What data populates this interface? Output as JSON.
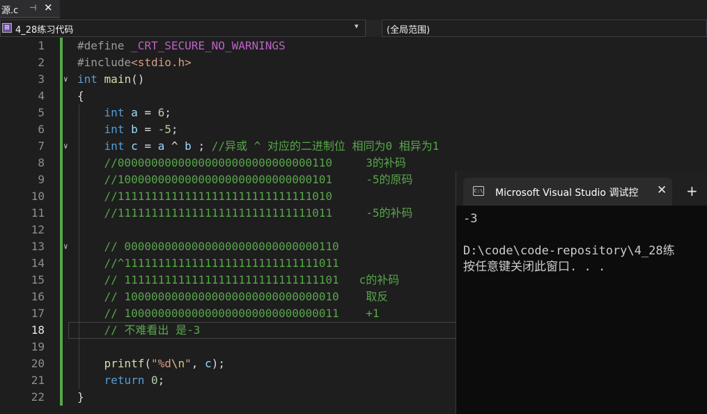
{
  "tab": {
    "title": "源.c",
    "pin_icon": "pin-icon",
    "close_icon": "close-icon"
  },
  "navbar": {
    "project": "4_28练习代码",
    "scope": "(全局范围)"
  },
  "editor": {
    "active_line": "18",
    "lines": [
      {
        "n": "1",
        "p": [
          "#define",
          " ",
          "_CRT_SECURE_NO_WARNINGS"
        ]
      },
      {
        "n": "2",
        "p": [
          "#include",
          "<stdio.h>"
        ]
      },
      {
        "n": "3",
        "p": [
          "int",
          " ",
          "main",
          "()"
        ]
      },
      {
        "n": "4",
        "p": [
          "{"
        ]
      },
      {
        "n": "5",
        "p": [
          "    ",
          "int",
          " ",
          "a",
          " = ",
          "6",
          ";"
        ]
      },
      {
        "n": "6",
        "p": [
          "    ",
          "int",
          " ",
          "b",
          " = ",
          "-5",
          ";"
        ]
      },
      {
        "n": "7",
        "p": [
          "    ",
          "int",
          " ",
          "c",
          " = ",
          "a",
          " ^ ",
          "b",
          " ; ",
          "//异或 ^ 对应的二进制位 相同为0 相异为1"
        ]
      },
      {
        "n": "8",
        "p": [
          "    ",
          "//00000000000000000000000000000110     3的补码"
        ]
      },
      {
        "n": "9",
        "p": [
          "    ",
          "//10000000000000000000000000000101     -5的原码"
        ]
      },
      {
        "n": "10",
        "p": [
          "    ",
          "//11111111111111111111111111111010"
        ]
      },
      {
        "n": "11",
        "p": [
          "    ",
          "//11111111111111111111111111111011     -5的补码"
        ]
      },
      {
        "n": "12",
        "p": [
          ""
        ]
      },
      {
        "n": "13",
        "p": [
          "    ",
          "// 00000000000000000000000000000110"
        ]
      },
      {
        "n": "14",
        "p": [
          "    ",
          "//^11111111111111111111111111111011"
        ]
      },
      {
        "n": "15",
        "p": [
          "    ",
          "// 11111111111111111111111111111101   c的补码"
        ]
      },
      {
        "n": "16",
        "p": [
          "    ",
          "// 10000000000000000000000000000010    取反"
        ]
      },
      {
        "n": "17",
        "p": [
          "    ",
          "// 10000000000000000000000000000011    +1"
        ]
      },
      {
        "n": "18",
        "p": [
          "    ",
          "// 不难看出 是-3"
        ]
      },
      {
        "n": "19",
        "p": [
          ""
        ]
      },
      {
        "n": "20",
        "p": [
          "    ",
          "printf",
          "(",
          "\"%d",
          "\\n",
          "\"",
          ", ",
          "c",
          ");"
        ]
      },
      {
        "n": "21",
        "p": [
          "    ",
          "return",
          " ",
          "0",
          ";"
        ]
      },
      {
        "n": "22",
        "p": [
          "}"
        ]
      }
    ]
  },
  "terminal": {
    "tab_title": "Microsoft Visual Studio 调试控",
    "icon": "console-icon",
    "new_tab_label": "+",
    "output": [
      "-3",
      "",
      "D:\\code\\code-repository\\4_28练",
      "按任意键关闭此窗口. . ."
    ]
  }
}
